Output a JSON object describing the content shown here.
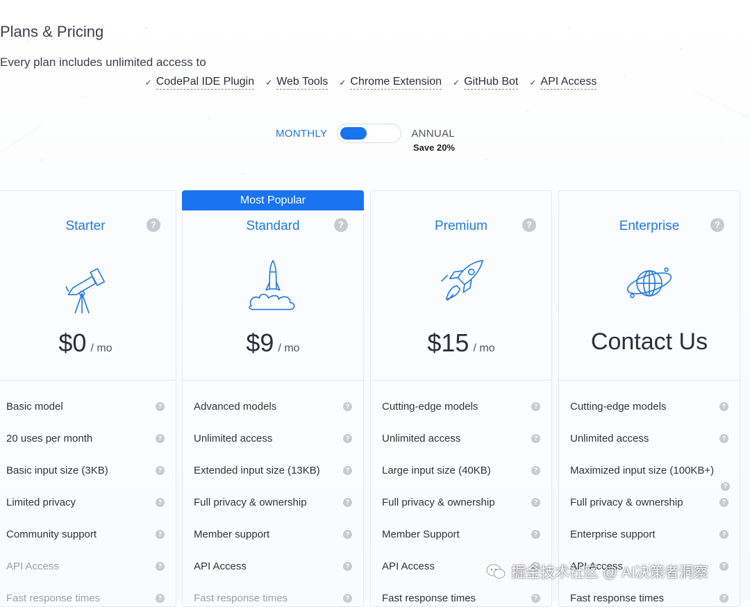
{
  "header": {
    "title": "Plans & Pricing",
    "subtitle": "Every plan includes unlimited access to",
    "tools": [
      "CodePal IDE Plugin",
      "Web Tools",
      "Chrome Extension",
      "GitHub Bot",
      "API Access"
    ],
    "check_glyph": "✓"
  },
  "billing": {
    "monthly": "MONTHLY",
    "annual": "ANNUAL",
    "save": "Save 20%",
    "selected": "monthly"
  },
  "colors": {
    "accent": "#1a73f0",
    "link": "#1f7ae0",
    "help": "#c7cbd1"
  },
  "plans": [
    {
      "name": "Starter",
      "icon": "telescope-icon",
      "price": "$0",
      "per": "/ mo",
      "contact": "",
      "features": [
        {
          "text": "Basic model",
          "muted": false
        },
        {
          "text": "20 uses per month",
          "muted": false
        },
        {
          "text": "Basic input size (3KB)",
          "muted": false
        },
        {
          "text": "Limited privacy",
          "muted": false
        },
        {
          "text": "Community support",
          "muted": false
        },
        {
          "text": "API Access",
          "muted": true
        },
        {
          "text": "Fast response times",
          "muted": true
        }
      ]
    },
    {
      "name": "Standard",
      "icon": "rocket-launch-icon",
      "price": "$9",
      "per": "/ mo",
      "contact": "",
      "badge": "Most Popular",
      "features": [
        {
          "text": "Advanced models",
          "muted": false
        },
        {
          "text": "Unlimited access",
          "muted": false
        },
        {
          "text": "Extended input size (13KB)",
          "muted": false
        },
        {
          "text": "Full privacy & ownership",
          "muted": false
        },
        {
          "text": "Member support",
          "muted": false
        },
        {
          "text": "API Access",
          "muted": false
        },
        {
          "text": "Fast response times",
          "muted": true
        }
      ]
    },
    {
      "name": "Premium",
      "icon": "rocket-flying-icon",
      "price": "$15",
      "per": "/ mo",
      "contact": "",
      "features": [
        {
          "text": "Cutting-edge models",
          "muted": false
        },
        {
          "text": "Unlimited access",
          "muted": false
        },
        {
          "text": "Large input size (40KB)",
          "muted": false
        },
        {
          "text": "Full privacy & ownership",
          "muted": false
        },
        {
          "text": "Member Support",
          "muted": false
        },
        {
          "text": "API Access",
          "muted": false
        },
        {
          "text": "Fast response times",
          "muted": false
        }
      ]
    },
    {
      "name": "Enterprise",
      "icon": "globe-orbit-icon",
      "price": "",
      "per": "",
      "contact": "Contact Us",
      "features": [
        {
          "text": "Cutting-edge models",
          "muted": false
        },
        {
          "text": "Unlimited access",
          "muted": false
        },
        {
          "text": "Maximized input size (100KB+)",
          "muted": false
        },
        {
          "text": "Full privacy & ownership",
          "muted": false
        },
        {
          "text": "Enterprise support",
          "muted": false
        },
        {
          "text": "API Access",
          "muted": false
        },
        {
          "text": "Fast response times",
          "muted": false
        }
      ]
    }
  ],
  "help_glyph": "?",
  "watermark": {
    "text": "掘金技术社区 @ AI决策者洞察",
    "icon": "wechat-icon"
  }
}
